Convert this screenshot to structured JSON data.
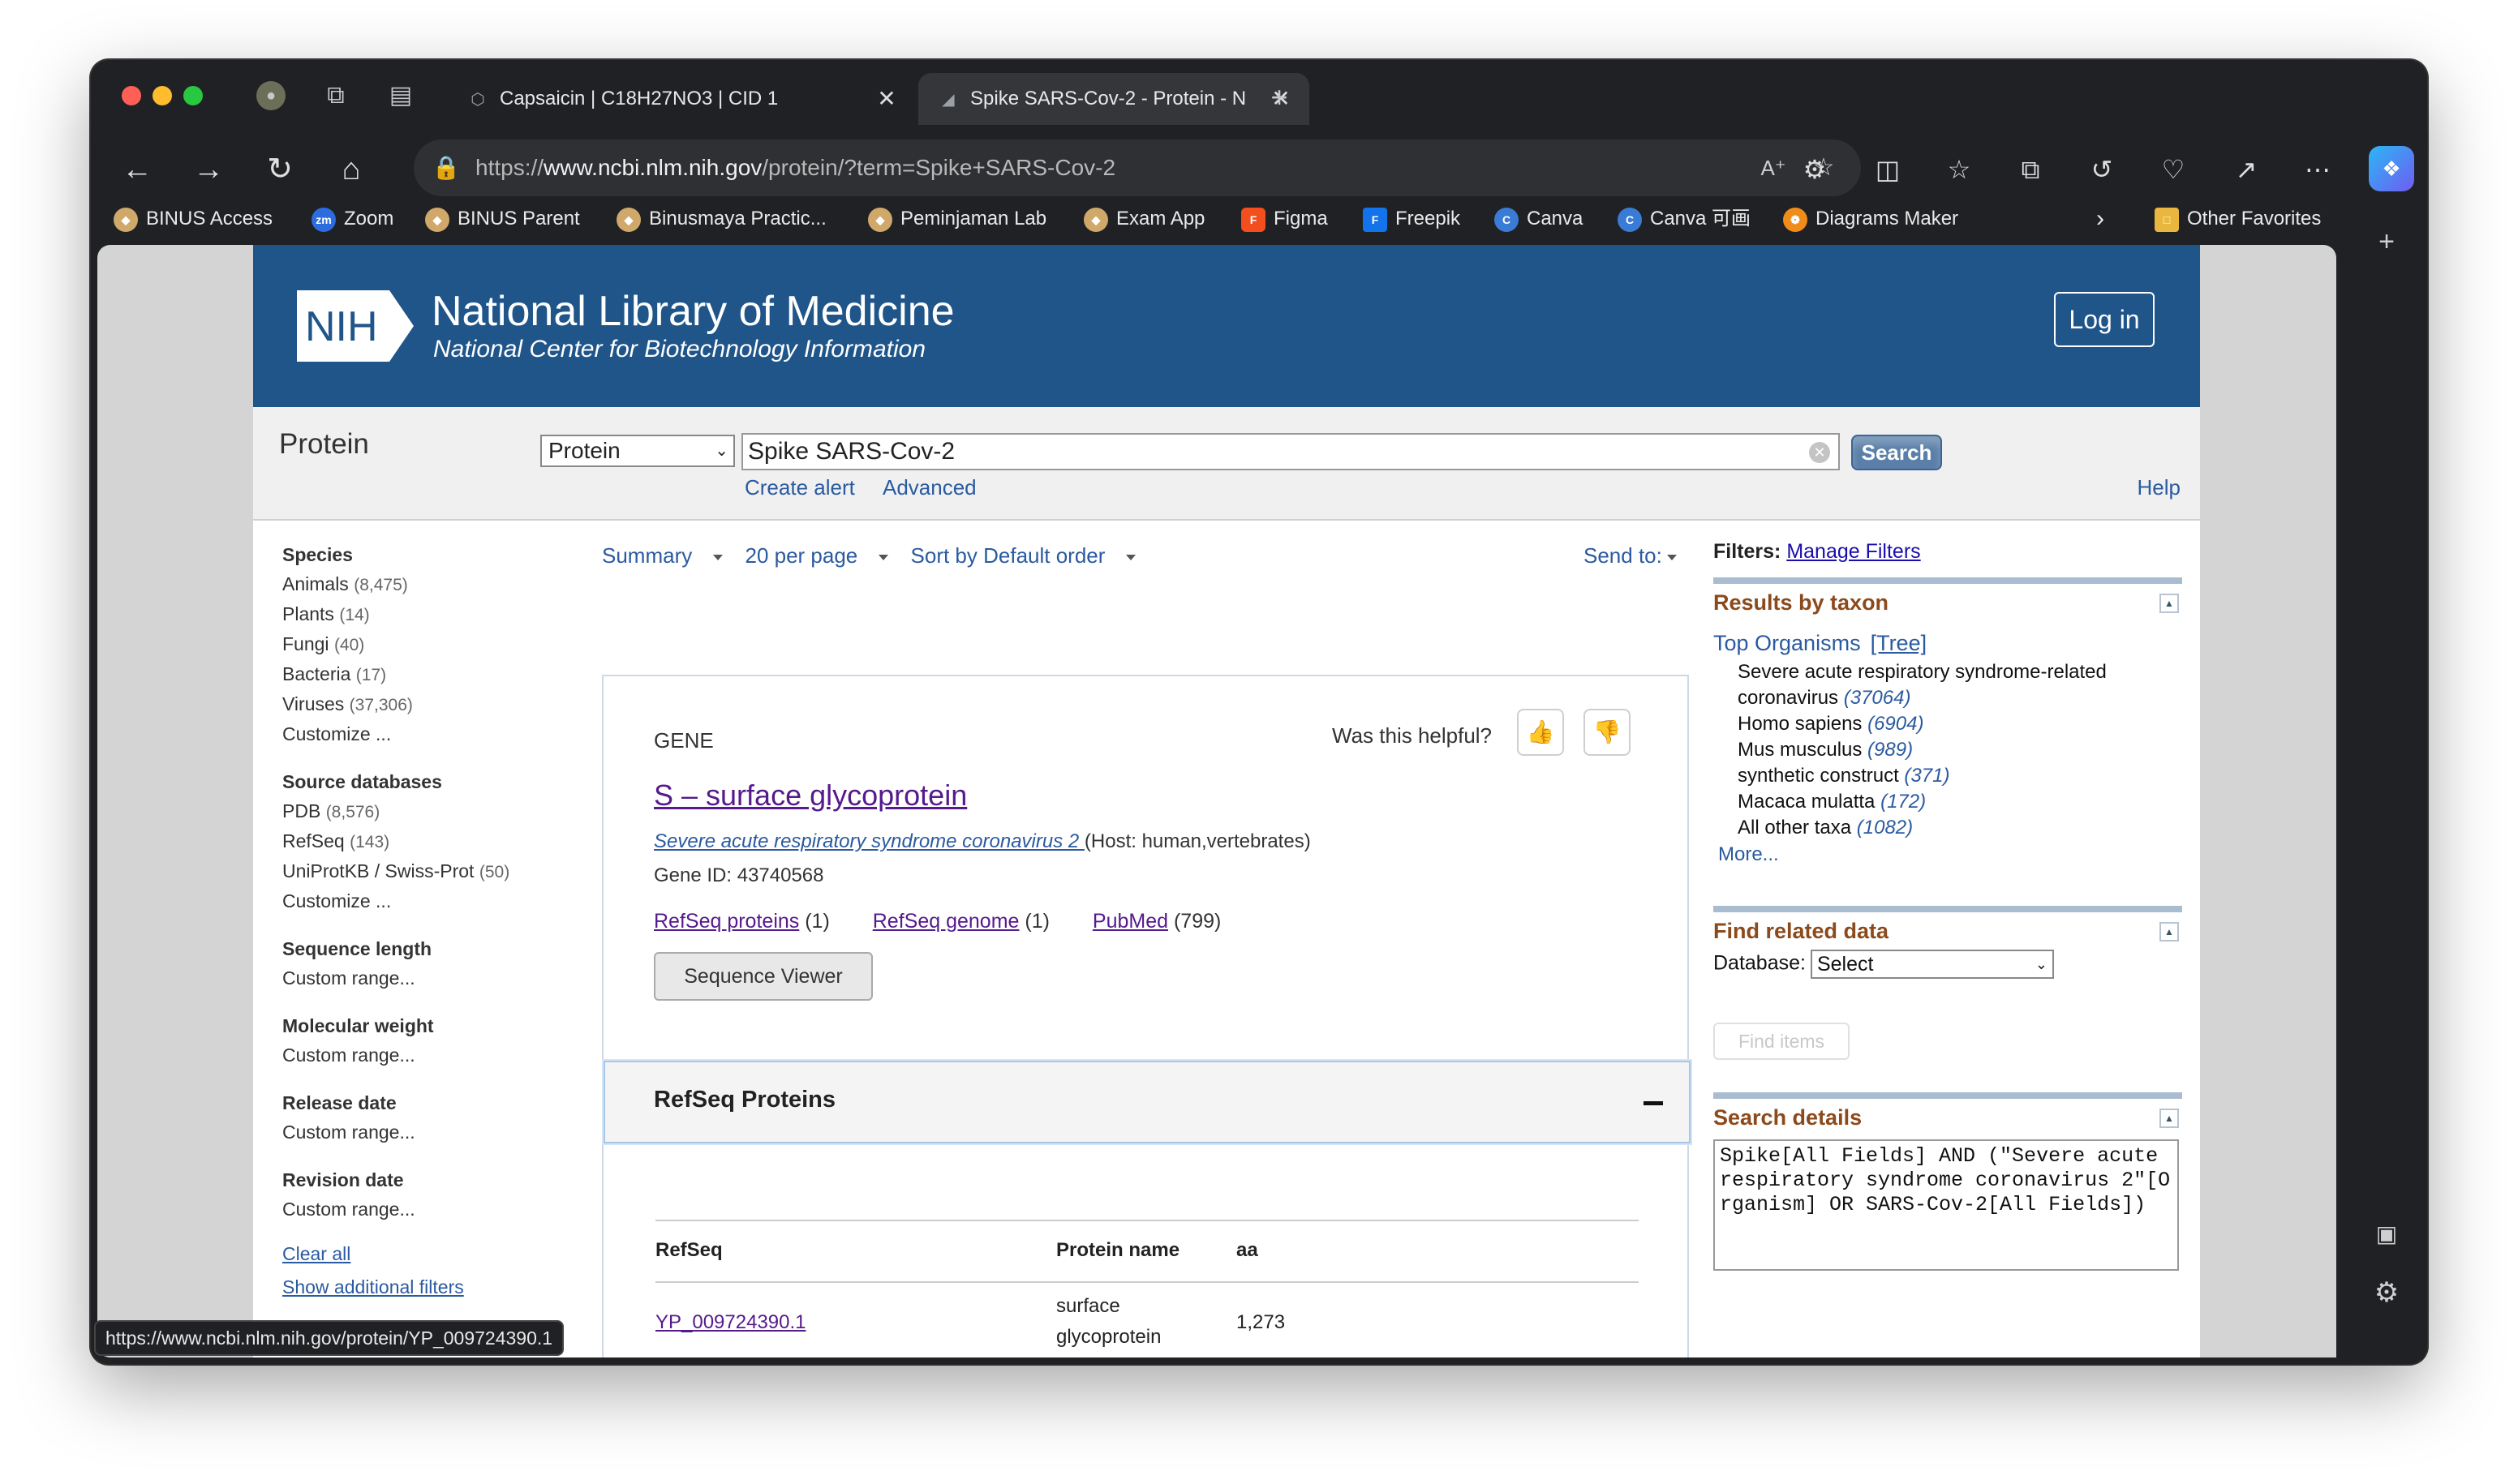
{
  "browser": {
    "tabs": [
      {
        "title": "Capsaicin | C18H27NO3 | CID 1",
        "active": false
      },
      {
        "title": "Spike SARS-Cov-2 - Protein - N",
        "active": true
      }
    ],
    "url_prefix": "https://",
    "url_host": "www.ncbi.nlm.nih.gov",
    "url_path": "/protein/?term=Spike+SARS-Cov-2",
    "bookmarks": [
      "BINUS Access",
      "Zoom",
      "BINUS Parent",
      "Binusmaya Practic...",
      "Peminjaman Lab",
      "Exam App",
      "Figma",
      "Freepik",
      "Canva",
      "Canva 可画",
      "Diagrams Maker"
    ],
    "other_favorites": "Other Favorites",
    "status_url": "https://www.ncbi.nlm.nih.gov/protein/YP_009724390.1"
  },
  "header": {
    "logo_text": "NIH",
    "org_name": "National Library of Medicine",
    "org_sub": "National Center for Biotechnology Information",
    "login": "Log in"
  },
  "search": {
    "db_title": "Protein",
    "db_selected": "Protein",
    "query": "Spike SARS-Cov-2",
    "button": "Search",
    "create_alert": "Create alert",
    "advanced": "Advanced",
    "help": "Help"
  },
  "facets": [
    {
      "heading": "Species",
      "items": [
        {
          "label": "Animals",
          "count": "(8,475)"
        },
        {
          "label": "Plants",
          "count": "(14)"
        },
        {
          "label": "Fungi",
          "count": "(40)"
        },
        {
          "label": "Bacteria",
          "count": "(17)"
        },
        {
          "label": "Viruses",
          "count": "(37,306)"
        },
        {
          "label": "Customize ...",
          "count": ""
        }
      ]
    },
    {
      "heading": "Source databases",
      "items": [
        {
          "label": "PDB",
          "count": "(8,576)"
        },
        {
          "label": "RefSeq",
          "count": "(143)"
        },
        {
          "label": "UniProtKB / Swiss-Prot",
          "count": "(50)"
        },
        {
          "label": "Customize ...",
          "count": ""
        }
      ]
    },
    {
      "heading": "Sequence length",
      "items": [
        {
          "label": "Custom range...",
          "count": ""
        }
      ]
    },
    {
      "heading": "Molecular weight",
      "items": [
        {
          "label": "Custom range...",
          "count": ""
        }
      ]
    },
    {
      "heading": "Release date",
      "items": [
        {
          "label": "Custom range...",
          "count": ""
        }
      ]
    },
    {
      "heading": "Revision date",
      "items": [
        {
          "label": "Custom range...",
          "count": ""
        }
      ]
    }
  ],
  "clear_all": "Clear all",
  "show_additional": "Show additional filters",
  "display": {
    "format": "Summary",
    "per_page": "20 per page",
    "sort": "Sort by Default order",
    "send_to": "Send to:"
  },
  "gene": {
    "type": "GENE",
    "helpful": "Was this helpful?",
    "name": "S – surface glycoprotein",
    "organism": "Severe acute respiratory syndrome coronavirus 2 ",
    "host": "(Host: human,vertebrates)",
    "gene_id": "Gene ID: 43740568",
    "links": [
      {
        "label": "RefSeq proteins",
        "count": "(1)"
      },
      {
        "label": "RefSeq genome",
        "count": "(1)"
      },
      {
        "label": "PubMed",
        "count": "(799)"
      }
    ],
    "seq_viewer": "Sequence Viewer"
  },
  "refseq_proteins": {
    "title": "RefSeq Proteins",
    "columns": [
      "RefSeq",
      "Protein name",
      "aa"
    ],
    "rows": [
      {
        "refseq": "YP_009724390.1",
        "name_line1": "surface",
        "name_line2": "glycoprotein",
        "aa": "1,273"
      }
    ]
  },
  "filters": {
    "label": "Filters:",
    "manage": "Manage Filters"
  },
  "taxon": {
    "title": "Results by taxon",
    "top": "Top Organisms",
    "tree": "[Tree]",
    "items": [
      {
        "line1": "Severe acute respiratory syndrome-related",
        "name": "coronavirus",
        "count": "(37064)"
      },
      {
        "name": "Homo sapiens",
        "count": "(6904)"
      },
      {
        "name": "Mus musculus",
        "count": "(989)"
      },
      {
        "name": "synthetic construct",
        "count": "(371)"
      },
      {
        "name": "Macaca mulatta",
        "count": "(172)"
      },
      {
        "name": "All other taxa",
        "count": "(1082)"
      }
    ],
    "more": "More..."
  },
  "related": {
    "title": "Find related data",
    "db_label": "Database:",
    "db_selected": "Select",
    "find": "Find items"
  },
  "details": {
    "title": "Search details",
    "text": "Spike[All Fields] AND (\"Severe acute respiratory syndrome coronavirus 2\"[Organism] OR SARS-Cov-2[All Fields])"
  }
}
